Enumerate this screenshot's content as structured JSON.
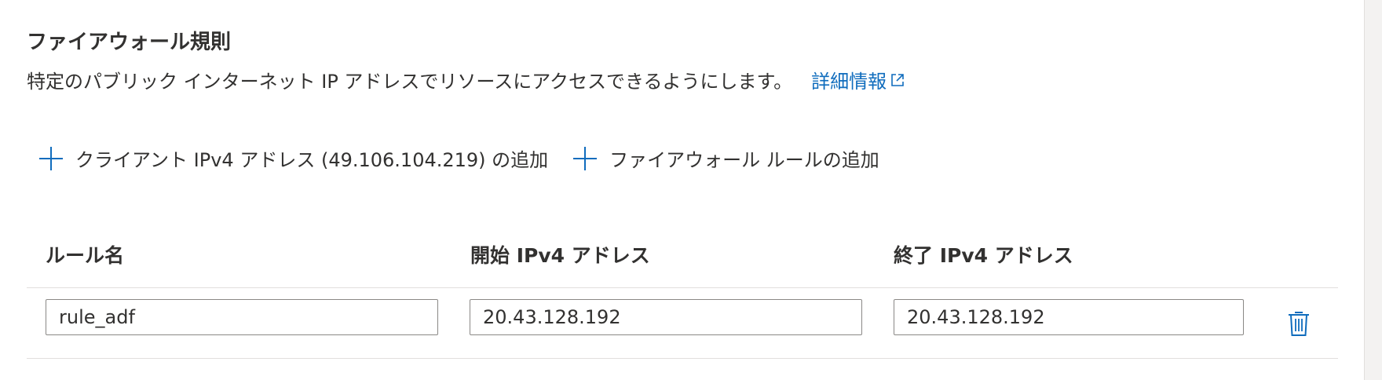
{
  "section": {
    "title": "ファイアウォール規則",
    "description": "特定のパブリック インターネット IP アドレスでリソースにアクセスできるようにします。",
    "learn_more": "詳細情報"
  },
  "actions": {
    "add_client_ip": "クライアント IPv4 アドレス (49.106.104.219) の追加",
    "add_rule": "ファイアウォール ルールの追加"
  },
  "table": {
    "headers": {
      "rule_name": "ルール名",
      "start_ip": "開始 IPv4 アドレス",
      "end_ip": "終了 IPv4 アドレス"
    },
    "rows": [
      {
        "rule_name": "rule_adf",
        "start_ip": "20.43.128.192",
        "end_ip": "20.43.128.192"
      }
    ]
  },
  "colors": {
    "link": "#0f6cbd",
    "text": "#323130",
    "border": "#8a8886"
  },
  "icons": {
    "external_link": "external-link-icon",
    "add": "plus-icon",
    "delete": "trash-icon"
  }
}
